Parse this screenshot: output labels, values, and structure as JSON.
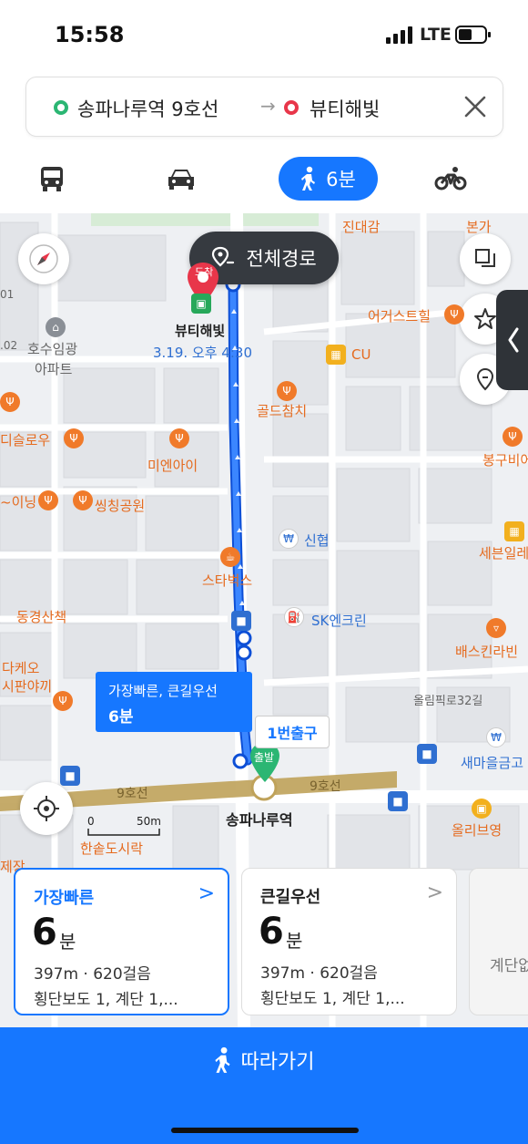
{
  "status_bar": {
    "time": "15:58",
    "network": "LTE"
  },
  "search": {
    "origin": "송파나루역 9호선",
    "arrow": "→",
    "destination": "뷰티해빛"
  },
  "modes": {
    "walk_label": "6분",
    "selected": "walk"
  },
  "map": {
    "full_route_label": "전체경로",
    "destination_name": "뷰티해빛",
    "destination_datetime": "3.19. 오후 4:30",
    "arrival_tag": "도착",
    "departure_tag": "출발",
    "route_tip_line1": "가장빠른, 큰길우선",
    "route_tip_line2": "6분",
    "exit_label": "1번출구",
    "station_name": "송파나루역",
    "line_label_left": "9호선",
    "line_label_right": "9호선",
    "road_label": "올림픽로32길",
    "scale_zero": "0",
    "scale_value": "50m",
    "pois": {
      "jindaegam": "진대감",
      "bonga": "본가",
      "ehoseu": "어거스트힐",
      "cu": "CU",
      "golden": "골드참치",
      "bonggu": "봉구비어",
      "hosuim1": "호수임광",
      "hosuim2": "아파트",
      "disl": "디슬로우",
      "mienai": "미엔아이",
      "ining": "~이닝",
      "ssing": "씽칭공원",
      "sinhyeop": "신협",
      "seven1": "세븐일레",
      "starbucks": "스타벅스",
      "sk": "SK엔크린",
      "donggyeong": "동경산책",
      "baskin": "배스킨라빈",
      "dakeo1": "다케오",
      "dakeo2": "시판야끼",
      "saemaeul": "새마을금고",
      "olive": "올리브영",
      "hansot": "한솥도시락",
      "jejang": "제장",
      "left01": "01",
      "left02": ".02"
    }
  },
  "route_cards": [
    {
      "title": "가장빠른",
      "minutes": "6",
      "unit": "분",
      "distance": "397m · 620걸음",
      "detail": "횡단보도 1, 계단 1,..."
    },
    {
      "title": "큰길우선",
      "minutes": "6",
      "unit": "분",
      "distance": "397m · 620걸음",
      "detail": "횡단보도 1, 계단 1,..."
    },
    {
      "detail": "계단없"
    }
  ],
  "follow_button": {
    "label": "따라가기"
  },
  "colors": {
    "accent": "#1677ff",
    "route_line": "#1e6ef5",
    "subway_line": "#bfa25a",
    "origin_green": "#2bb673",
    "dest_red": "#e8364a",
    "dark_button": "#363a40"
  }
}
